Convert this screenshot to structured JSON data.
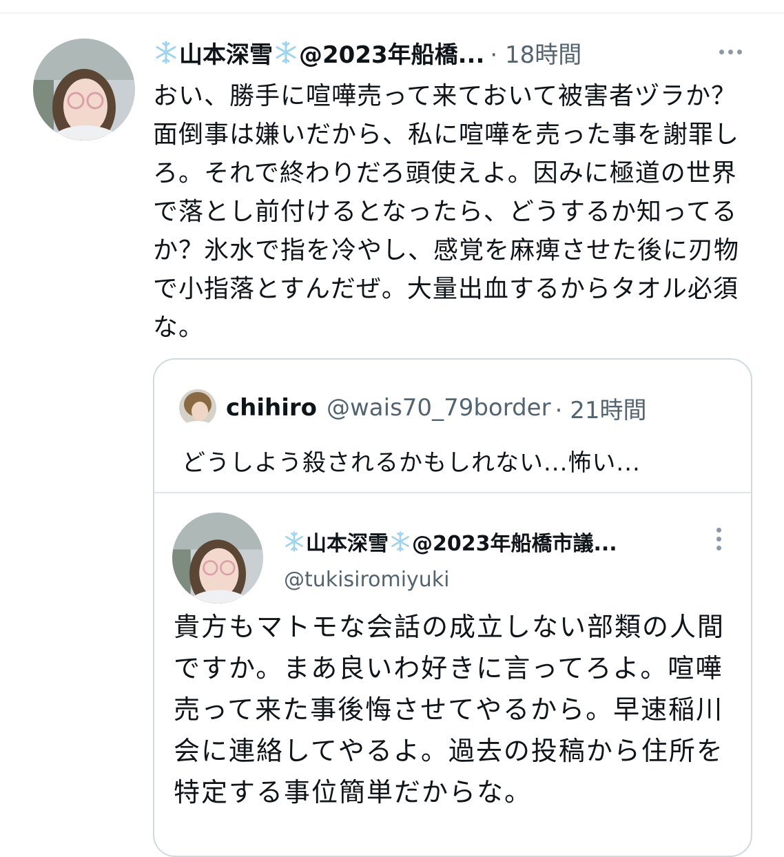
{
  "tweet": {
    "display_name": "山本深雪",
    "handle_truncated": "@2023年船橋...",
    "time": "· 18時間",
    "body": "おい、勝手に喧嘩売って来ておいて被害者ヅラか？面倒事は嫌いだから、私に喧嘩を売った事を謝罪しろ。それで終わりだろ頭使えよ。因みに極道の世界で落とし前付けるとなったら、どうするか知ってるか？氷水で指を冷やし、感覚を麻痺させた後に刃物で小指落とすんだぜ。大量出血するからタオル必須な。",
    "name_icon": "snowflake-icon"
  },
  "quote": {
    "display_name": "chihiro",
    "handle": "@wais70_79border",
    "time": "· 21時間",
    "body": "どうしよう殺されるかもしれない...怖い..."
  },
  "embedded": {
    "display_name": "山本深雪",
    "handle_truncated": "@2023年船橋市議...",
    "username": "@tukisiromiyuki",
    "body": "貴方もマトモな会話の成立しない部類の人間ですか。まあ良いわ好きに言ってろよ。喧嘩売って来た事後悔させてやるから。早速稲川会に連絡してやるよ。過去の投稿から住所を特定する事位簡単だからな。"
  },
  "colors": {
    "text_primary": "#0f1419",
    "text_secondary": "#536471",
    "border": "#cfd9de",
    "snowflake": "#9fd3ee"
  }
}
